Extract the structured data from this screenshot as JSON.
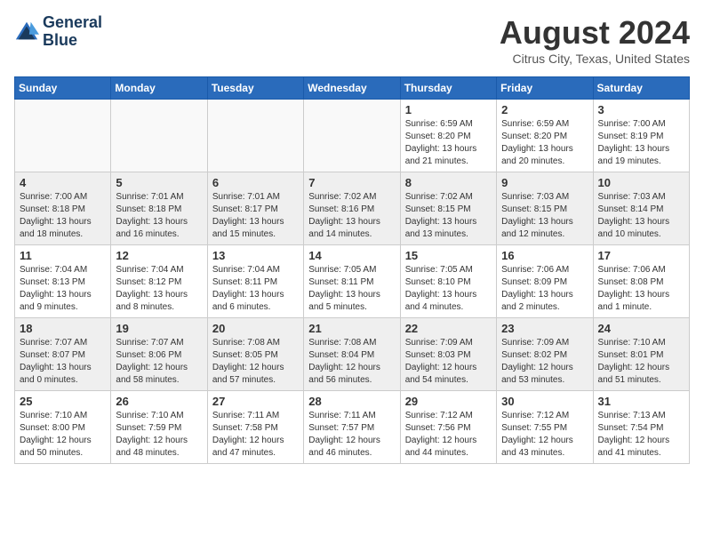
{
  "header": {
    "logo_line1": "General",
    "logo_line2": "Blue",
    "month_year": "August 2024",
    "location": "Citrus City, Texas, United States"
  },
  "weekdays": [
    "Sunday",
    "Monday",
    "Tuesday",
    "Wednesday",
    "Thursday",
    "Friday",
    "Saturday"
  ],
  "rows": [
    {
      "cells": [
        {
          "empty": true
        },
        {
          "empty": true
        },
        {
          "empty": true
        },
        {
          "empty": true
        },
        {
          "day": 1,
          "sunrise": "6:59 AM",
          "sunset": "8:20 PM",
          "daylight": "13 hours and 21 minutes."
        },
        {
          "day": 2,
          "sunrise": "6:59 AM",
          "sunset": "8:20 PM",
          "daylight": "13 hours and 20 minutes."
        },
        {
          "day": 3,
          "sunrise": "7:00 AM",
          "sunset": "8:19 PM",
          "daylight": "13 hours and 19 minutes."
        }
      ]
    },
    {
      "cells": [
        {
          "day": 4,
          "sunrise": "7:00 AM",
          "sunset": "8:18 PM",
          "daylight": "13 hours and 18 minutes."
        },
        {
          "day": 5,
          "sunrise": "7:01 AM",
          "sunset": "8:18 PM",
          "daylight": "13 hours and 16 minutes."
        },
        {
          "day": 6,
          "sunrise": "7:01 AM",
          "sunset": "8:17 PM",
          "daylight": "13 hours and 15 minutes."
        },
        {
          "day": 7,
          "sunrise": "7:02 AM",
          "sunset": "8:16 PM",
          "daylight": "13 hours and 14 minutes."
        },
        {
          "day": 8,
          "sunrise": "7:02 AM",
          "sunset": "8:15 PM",
          "daylight": "13 hours and 13 minutes."
        },
        {
          "day": 9,
          "sunrise": "7:03 AM",
          "sunset": "8:15 PM",
          "daylight": "13 hours and 12 minutes."
        },
        {
          "day": 10,
          "sunrise": "7:03 AM",
          "sunset": "8:14 PM",
          "daylight": "13 hours and 10 minutes."
        }
      ]
    },
    {
      "cells": [
        {
          "day": 11,
          "sunrise": "7:04 AM",
          "sunset": "8:13 PM",
          "daylight": "13 hours and 9 minutes."
        },
        {
          "day": 12,
          "sunrise": "7:04 AM",
          "sunset": "8:12 PM",
          "daylight": "13 hours and 8 minutes."
        },
        {
          "day": 13,
          "sunrise": "7:04 AM",
          "sunset": "8:11 PM",
          "daylight": "13 hours and 6 minutes."
        },
        {
          "day": 14,
          "sunrise": "7:05 AM",
          "sunset": "8:11 PM",
          "daylight": "13 hours and 5 minutes."
        },
        {
          "day": 15,
          "sunrise": "7:05 AM",
          "sunset": "8:10 PM",
          "daylight": "13 hours and 4 minutes."
        },
        {
          "day": 16,
          "sunrise": "7:06 AM",
          "sunset": "8:09 PM",
          "daylight": "13 hours and 2 minutes."
        },
        {
          "day": 17,
          "sunrise": "7:06 AM",
          "sunset": "8:08 PM",
          "daylight": "13 hours and 1 minute."
        }
      ]
    },
    {
      "cells": [
        {
          "day": 18,
          "sunrise": "7:07 AM",
          "sunset": "8:07 PM",
          "daylight": "13 hours and 0 minutes."
        },
        {
          "day": 19,
          "sunrise": "7:07 AM",
          "sunset": "8:06 PM",
          "daylight": "12 hours and 58 minutes."
        },
        {
          "day": 20,
          "sunrise": "7:08 AM",
          "sunset": "8:05 PM",
          "daylight": "12 hours and 57 minutes."
        },
        {
          "day": 21,
          "sunrise": "7:08 AM",
          "sunset": "8:04 PM",
          "daylight": "12 hours and 56 minutes."
        },
        {
          "day": 22,
          "sunrise": "7:09 AM",
          "sunset": "8:03 PM",
          "daylight": "12 hours and 54 minutes."
        },
        {
          "day": 23,
          "sunrise": "7:09 AM",
          "sunset": "8:02 PM",
          "daylight": "12 hours and 53 minutes."
        },
        {
          "day": 24,
          "sunrise": "7:10 AM",
          "sunset": "8:01 PM",
          "daylight": "12 hours and 51 minutes."
        }
      ]
    },
    {
      "cells": [
        {
          "day": 25,
          "sunrise": "7:10 AM",
          "sunset": "8:00 PM",
          "daylight": "12 hours and 50 minutes."
        },
        {
          "day": 26,
          "sunrise": "7:10 AM",
          "sunset": "7:59 PM",
          "daylight": "12 hours and 48 minutes."
        },
        {
          "day": 27,
          "sunrise": "7:11 AM",
          "sunset": "7:58 PM",
          "daylight": "12 hours and 47 minutes."
        },
        {
          "day": 28,
          "sunrise": "7:11 AM",
          "sunset": "7:57 PM",
          "daylight": "12 hours and 46 minutes."
        },
        {
          "day": 29,
          "sunrise": "7:12 AM",
          "sunset": "7:56 PM",
          "daylight": "12 hours and 44 minutes."
        },
        {
          "day": 30,
          "sunrise": "7:12 AM",
          "sunset": "7:55 PM",
          "daylight": "12 hours and 43 minutes."
        },
        {
          "day": 31,
          "sunrise": "7:13 AM",
          "sunset": "7:54 PM",
          "daylight": "12 hours and 41 minutes."
        }
      ]
    }
  ],
  "row_styles": [
    "row-white",
    "row-gray",
    "row-white",
    "row-gray",
    "row-white"
  ]
}
